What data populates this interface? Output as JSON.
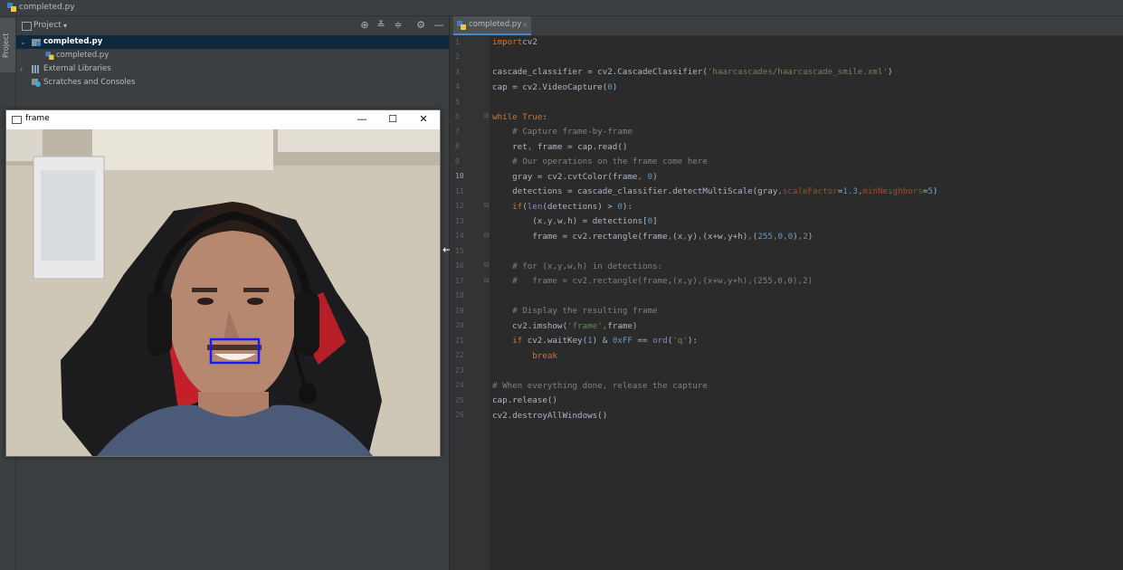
{
  "window": {
    "title": "completed.py"
  },
  "sidebar": {
    "tab_label": "Project"
  },
  "project_panel": {
    "title": "Project",
    "dropdown": "▾",
    "tree": [
      {
        "label": "completed.py",
        "level": 0,
        "expanded": true,
        "selected": true
      },
      {
        "label": "completed.py",
        "level": 1
      },
      {
        "label": "External Libraries",
        "level": 0,
        "expanded": false
      },
      {
        "label": "Scratches and Consoles",
        "level": 0
      }
    ]
  },
  "frame_window": {
    "title": "frame",
    "buttons": {
      "minimize": "—",
      "maximize": "☐",
      "close": "✕"
    }
  },
  "editor": {
    "tab": {
      "label": "completed.py",
      "close": "×"
    },
    "current_line": 10,
    "line_numbers": [
      "1",
      "2",
      "3",
      "4",
      "5",
      "6",
      "7",
      "8",
      "9",
      "10",
      "11",
      "12",
      "13",
      "14",
      "15",
      "16",
      "17",
      "18",
      "19",
      "20",
      "21",
      "22",
      "23",
      "24",
      "25",
      "26"
    ]
  },
  "colors": {
    "editor_bg": "#2b2b2b",
    "gutter_bg": "#313335",
    "panel_bg": "#3c3f41",
    "selection": "#0d293e",
    "keyword": "#cc7832",
    "string": "#6a8759",
    "number": "#6897bb",
    "comment": "#808080",
    "detection_box": "#1a1aff"
  },
  "icons": [
    "python-file-icon",
    "locate-icon",
    "expand-all-icon",
    "collapse-all-icon",
    "gear-icon",
    "hide-icon",
    "resize-cursor-icon"
  ]
}
